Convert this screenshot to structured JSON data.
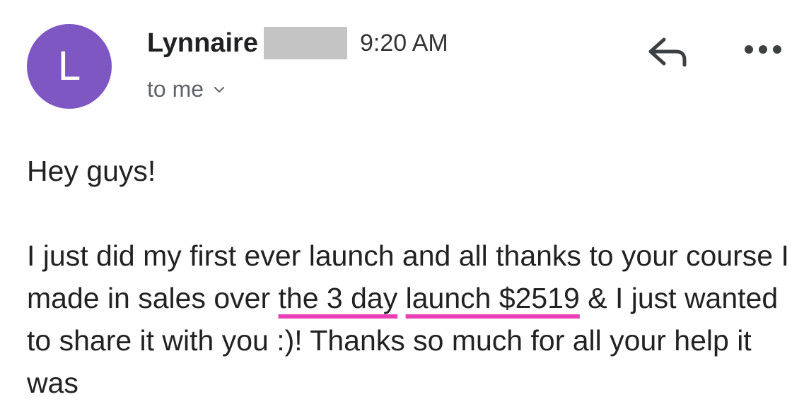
{
  "sender": {
    "avatar_letter": "L",
    "avatar_color": "#7e57c2",
    "name": "Lynnaire",
    "time": "9:20 AM"
  },
  "recipient": {
    "label": "to me"
  },
  "actions": {
    "reply_icon": "reply-icon",
    "more_icon": "more-options-icon"
  },
  "message": {
    "greeting": "Hey guys!",
    "part1": "I just did my first ever launch and all thanks to your course I made in sales over ",
    "highlight1": "the 3 day",
    "space": " ",
    "highlight2": "launch $2519",
    "part2": " & I just wanted to share it with you :)! Thanks so much for all your help it was"
  },
  "colors": {
    "underline_accent": "#ea3fb6",
    "redaction_gray": "#c4c4c4"
  }
}
